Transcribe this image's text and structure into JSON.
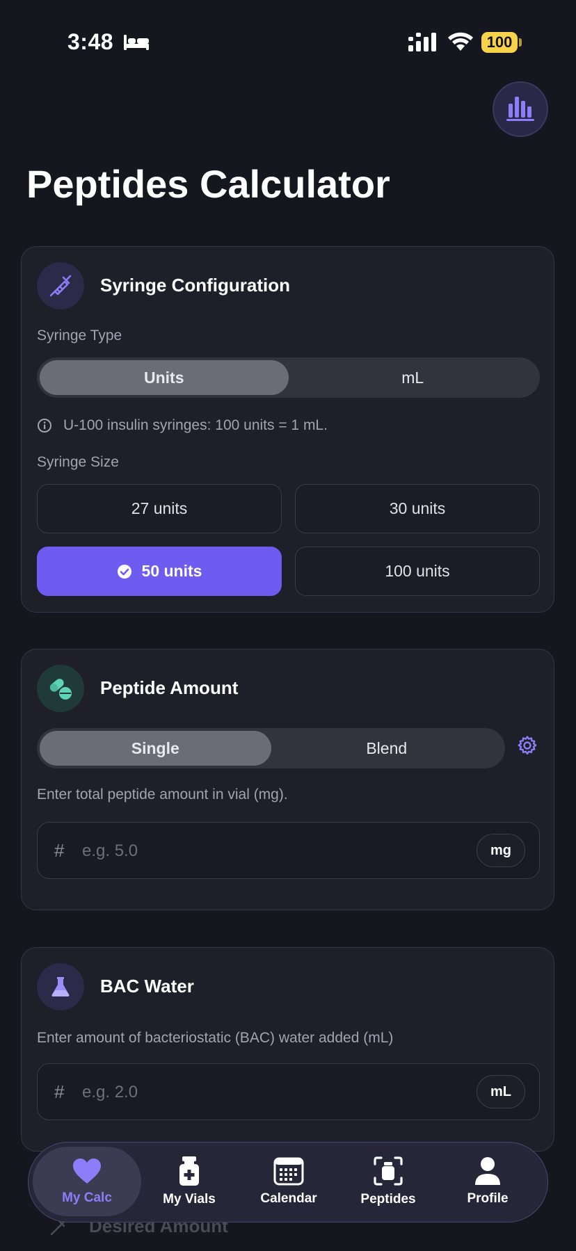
{
  "status_bar": {
    "time": "3:48",
    "battery": "100"
  },
  "page": {
    "title": "Peptides Calculator"
  },
  "syringe_card": {
    "title": "Syringe Configuration",
    "type_label": "Syringe Type",
    "type_options": [
      "Units",
      "mL"
    ],
    "type_selected": "Units",
    "info": "U-100 insulin syringes: 100 units = 1 mL.",
    "size_label": "Syringe Size",
    "sizes": [
      "27 units",
      "30 units",
      "50 units",
      "100 units"
    ],
    "size_selected": "50 units"
  },
  "peptide_card": {
    "title": "Peptide Amount",
    "mode_options": [
      "Single",
      "Blend"
    ],
    "mode_selected": "Single",
    "hint": "Enter total peptide amount in vial (mg).",
    "input_placeholder": "e.g. 5.0",
    "input_value": "",
    "unit": "mg"
  },
  "bac_card": {
    "title": "BAC Water",
    "hint": "Enter amount of bacteriostatic (BAC) water added (mL)",
    "input_placeholder": "e.g. 2.0",
    "input_value": "",
    "unit": "mL"
  },
  "next_card": {
    "title": "Desired Amount"
  },
  "tab_bar": {
    "items": [
      {
        "label": "My Calc",
        "icon": "heart-icon"
      },
      {
        "label": "My Vials",
        "icon": "vial-icon"
      },
      {
        "label": "Calendar",
        "icon": "calendar-icon"
      },
      {
        "label": "Peptides",
        "icon": "peptide-scan-icon"
      },
      {
        "label": "Profile",
        "icon": "person-icon"
      }
    ],
    "active": "My Calc"
  },
  "colors": {
    "background": "#16161f",
    "card": "#1f1f2a",
    "accent": "#6e5bf0",
    "accent_light": "#8e7df8",
    "mint": "#5fd3b8",
    "battery": "#f6d34a"
  }
}
